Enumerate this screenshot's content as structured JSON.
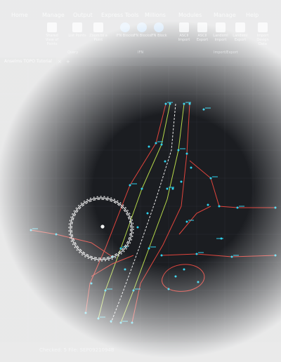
{
  "menu": {
    "tabs": [
      "Home",
      "Manage",
      "Output",
      "Express Tools",
      "Millions",
      "Modules",
      "Manage",
      "Help"
    ]
  },
  "ribbon": {
    "buttons": [
      {
        "label": "Shared View of Points",
        "icon": "share-points-icon",
        "color": "#c8cdd3"
      },
      {
        "label": "List Points",
        "icon": "list-points-icon",
        "color": "#c8cdd3"
      },
      {
        "label": "Zoom to a Point",
        "icon": "zoom-point-icon",
        "color": "#c8cdd3"
      },
      {
        "label": "IFN Blocks",
        "icon": "ifn-blocks-icon",
        "color": "#5aa3ea"
      },
      {
        "label": "IFN Blocks",
        "icon": "ifn-blocks-icon",
        "color": "#5aa3ea"
      },
      {
        "label": "IFN Block",
        "icon": "ifn-block-icon",
        "color": "#5aa3ea"
      },
      {
        "label": "ASCII Import",
        "icon": "ascii-import-icon",
        "color": "#c8cdd3"
      },
      {
        "label": "ASCII Export",
        "icon": "ascii-export-icon",
        "color": "#c8cdd3"
      },
      {
        "label": "Landxml Import",
        "icon": "landxml-import-icon",
        "color": "#c8cdd3"
      },
      {
        "label": "Landxml Export",
        "icon": "landxml-export-icon",
        "color": "#c8cdd3"
      },
      {
        "label": "Import Design Data",
        "icon": "import-design-icon",
        "color": "#c8cdd3"
      }
    ],
    "groups": [
      "Query",
      "IFN",
      "Import/Export"
    ]
  },
  "document": {
    "tab_label": "Anselms TOPO Tutorial",
    "close_symbol": "×",
    "new_tab_symbol": "+"
  },
  "status": {
    "text": "Checked: 5 File: SEP0921094B"
  },
  "colors": {
    "background": "#1b1d21",
    "red_line": "#e0443c",
    "green_line": "#b6d94a",
    "cyan_point": "#2fd3ee",
    "white_line": "#e8e8e8"
  }
}
